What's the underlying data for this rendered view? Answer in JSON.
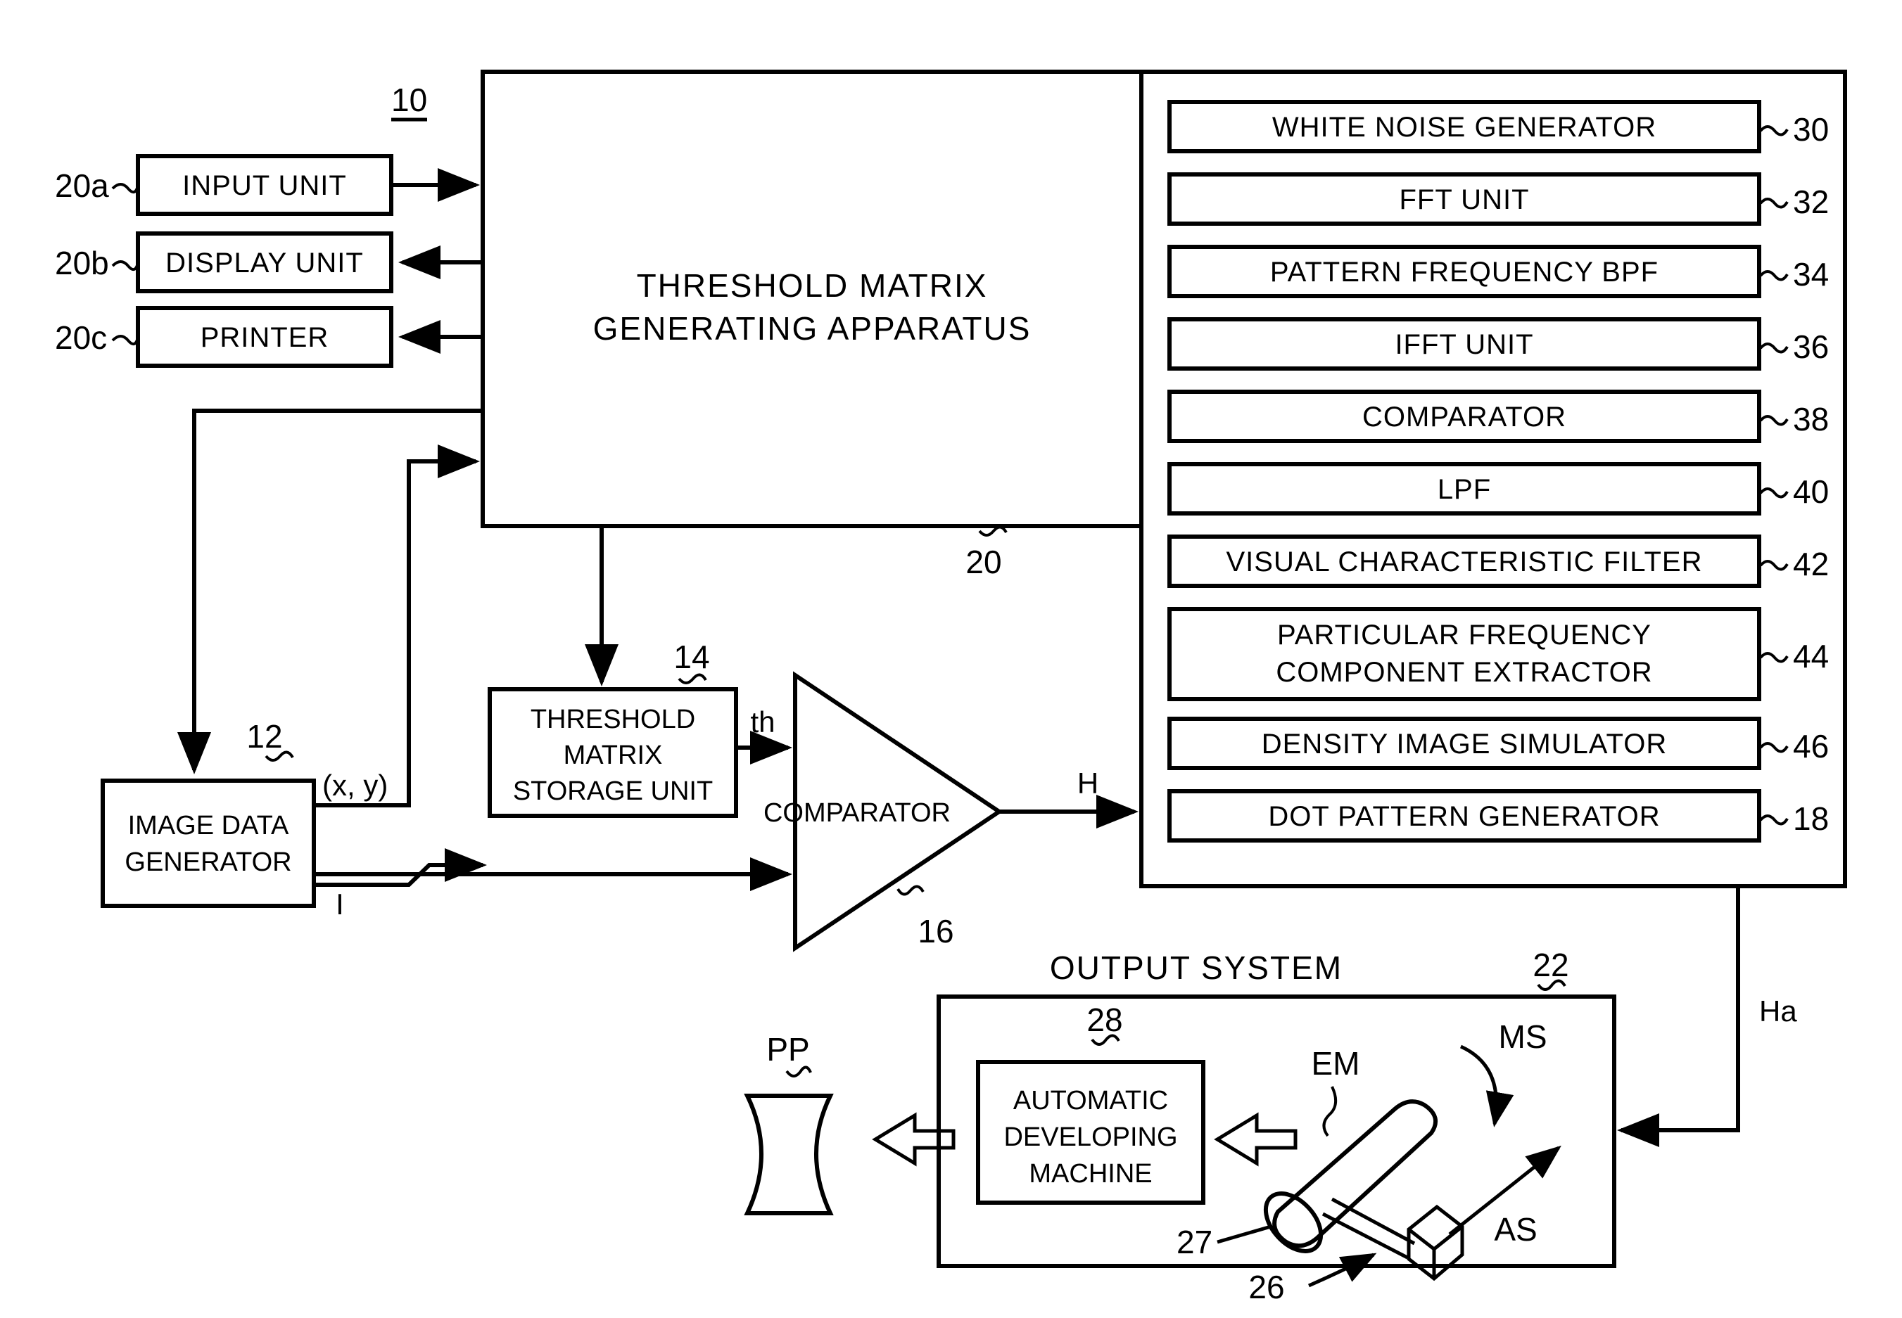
{
  "figure": {
    "ref_main": "10",
    "apparatus_title_line1": "THRESHOLD MATRIX",
    "apparatus_title_line2": "GENERATING APPARATUS",
    "outer_panel_ref": "20"
  },
  "peripherals": [
    {
      "ref": "20a",
      "label": "INPUT UNIT"
    },
    {
      "ref": "20b",
      "label": "DISPLAY UNIT"
    },
    {
      "ref": "20c",
      "label": "PRINTER"
    }
  ],
  "modules": [
    {
      "ref": "30",
      "label": "WHITE NOISE GENERATOR"
    },
    {
      "ref": "32",
      "label": "FFT UNIT"
    },
    {
      "ref": "34",
      "label": "PATTERN FREQUENCY BPF"
    },
    {
      "ref": "36",
      "label": "IFFT UNIT"
    },
    {
      "ref": "38",
      "label": "COMPARATOR"
    },
    {
      "ref": "40",
      "label": "LPF"
    },
    {
      "ref": "42",
      "label": "VISUAL CHARACTERISTIC FILTER"
    },
    {
      "ref": "44",
      "label_line1": "PARTICULAR FREQUENCY",
      "label_line2": "COMPONENT EXTRACTOR"
    },
    {
      "ref": "46",
      "label": "DENSITY IMAGE SIMULATOR"
    },
    {
      "ref": "18",
      "label": "DOT PATTERN GENERATOR"
    }
  ],
  "pipeline": {
    "image_data_generator": {
      "ref": "12",
      "label_line1": "IMAGE DATA",
      "label_line2": "GENERATOR"
    },
    "threshold_storage": {
      "ref": "14",
      "label_line1": "THRESHOLD",
      "label_line2": "MATRIX",
      "label_line3": "STORAGE UNIT"
    },
    "comparator": {
      "ref": "16",
      "label": "COMPARATOR"
    }
  },
  "signals": {
    "coords": "(x, y)",
    "image": "I",
    "threshold": "th",
    "halftone": "H",
    "halftone_a": "Ha"
  },
  "output_system": {
    "title": "OUTPUT SYSTEM",
    "ref": "22",
    "developer": {
      "ref": "28",
      "label_line1": "AUTOMATIC",
      "label_line2": "DEVELOPING",
      "label_line3": "MACHINE"
    },
    "printed_plate": "PP",
    "drum_ref": "27",
    "head_ref": "26",
    "exposure_medium": "EM",
    "main_scan": "MS",
    "aux_scan": "AS"
  },
  "colors": {
    "ink": "#000000",
    "paper": "#ffffff"
  }
}
